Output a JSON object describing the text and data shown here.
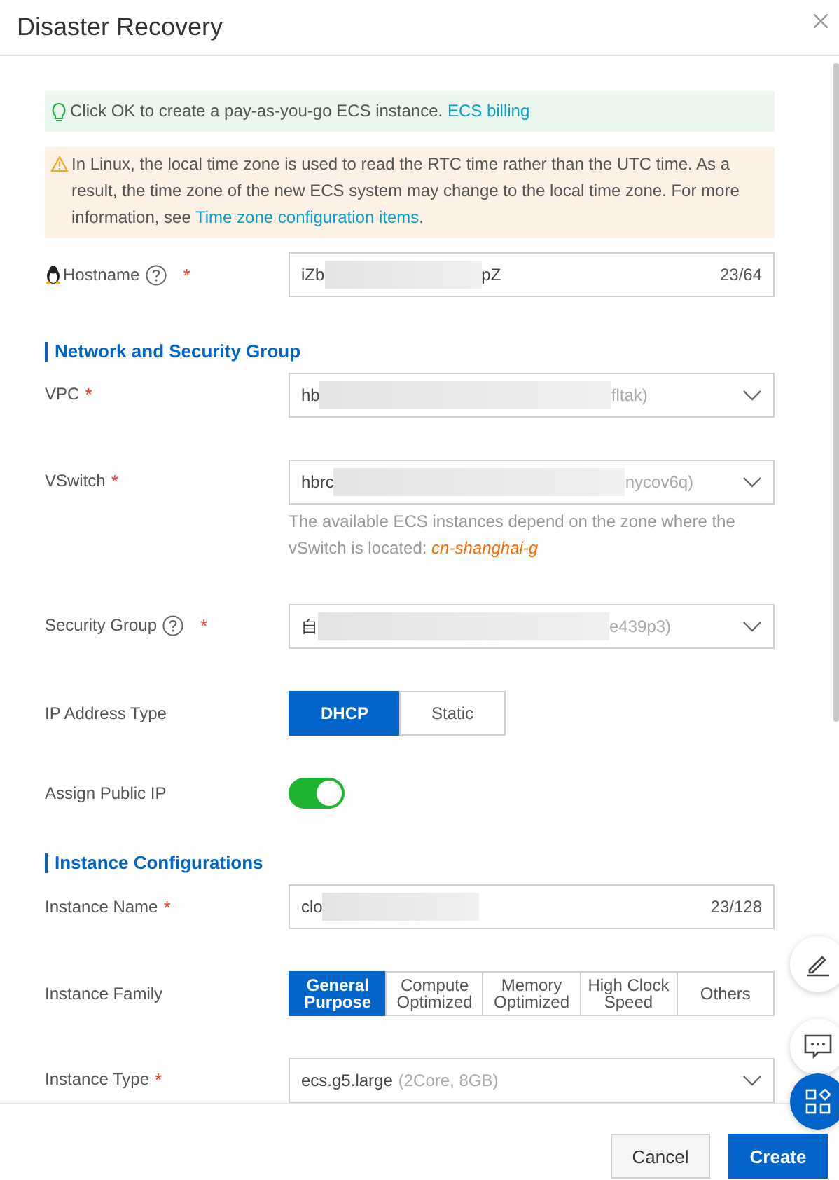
{
  "dialog": {
    "title": "Disaster Recovery"
  },
  "notices": [
    {
      "kind": "tip",
      "text": "Click OK to create a pay-as-you-go ECS instance.",
      "link": "ECS billing"
    },
    {
      "kind": "warning",
      "text": "In Linux, the local time zone is used to read the RTC time rather than the UTC time. As a result, the time zone of the new ECS system may change to the local time zone. For more information, see",
      "link": "Time zone configuration items",
      "after": "."
    }
  ],
  "rows": [
    {
      "kind": "input",
      "label": "Hostname",
      "os_icon": true,
      "help": true,
      "required": "*",
      "value_start": "iZb",
      "redacted": true,
      "value_end": "pZ",
      "counter": "23/64"
    },
    {
      "kind": "heading",
      "label": "Network and Security Group"
    },
    {
      "kind": "select",
      "label": "VPC",
      "required": "*",
      "value_start": "hb",
      "redacted": true,
      "value_end": "fltak)"
    },
    {
      "kind": "select",
      "label": "VSwitch",
      "required": "*",
      "value_start": "hbrc",
      "redacted": true,
      "value_end": "nycov6q)",
      "hint": "The available ECS instances depend on the zone where the vSwitch is located:",
      "hint_zone": "cn-shanghai-g"
    },
    {
      "kind": "select",
      "label": "Security Group",
      "help": true,
      "required": "*",
      "value_start": "自",
      "redacted": true,
      "value_end": "e439p3)"
    },
    {
      "kind": "segmented",
      "label": "IP Address Type",
      "options": [
        {
          "label": "DHCP",
          "selected": true
        },
        {
          "label": "Static",
          "selected": false
        }
      ]
    },
    {
      "kind": "switch",
      "label": "Assign Public IP",
      "on": true
    },
    {
      "kind": "heading",
      "label": "Instance Configurations"
    },
    {
      "kind": "input",
      "label": "Instance Name",
      "required": "*",
      "value_start": "clo",
      "redacted": true,
      "counter": "23/128"
    },
    {
      "kind": "segmented",
      "label": "Instance Family",
      "options": [
        {
          "label": "General Purpose",
          "selected": true
        },
        {
          "label": "Compute Optimized",
          "selected": false
        },
        {
          "label": "Memory Optimized",
          "selected": false
        },
        {
          "label": "High Clock Speed",
          "selected": false
        },
        {
          "label": "Others",
          "selected": false
        }
      ]
    },
    {
      "kind": "select",
      "label": "Instance Type",
      "required": "*",
      "value_start": "ecs.g5.large",
      "detail": "(2Core, 8GB)"
    }
  ],
  "footer": {
    "buttons": [
      {
        "label": "Cancel",
        "kind": "secondary"
      },
      {
        "label": "Create",
        "kind": "primary"
      }
    ]
  }
}
